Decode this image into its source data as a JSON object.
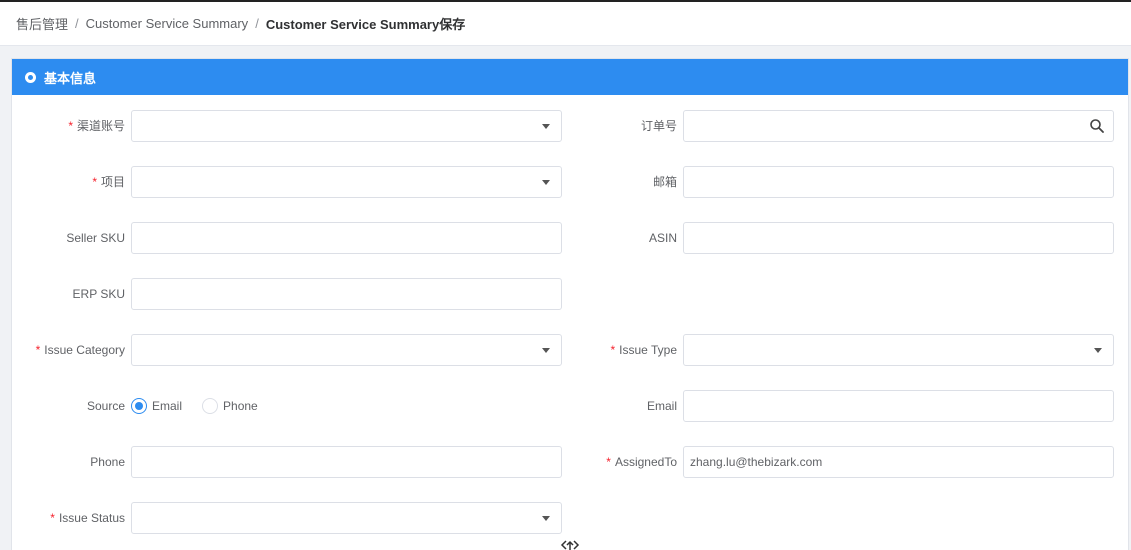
{
  "breadcrumb": {
    "items": [
      "售后管理",
      "Customer Service Summary"
    ],
    "separator": "/",
    "current": "Customer Service Summary保存"
  },
  "panel": {
    "title": "基本信息",
    "icon": "info-circle-icon"
  },
  "form": {
    "channel_account": {
      "label": "渠道账号",
      "required": true,
      "value": ""
    },
    "order_no": {
      "label": "订单号",
      "value": "",
      "icon": "search-icon"
    },
    "project": {
      "label": "项目",
      "required": true,
      "value": ""
    },
    "mailbox": {
      "label": "邮箱",
      "value": ""
    },
    "seller_sku": {
      "label": "Seller SKU",
      "value": ""
    },
    "asin": {
      "label": "ASIN",
      "value": ""
    },
    "erp_sku": {
      "label": "ERP SKU",
      "value": ""
    },
    "issue_category": {
      "label": "Issue Category",
      "required": true,
      "value": ""
    },
    "issue_type": {
      "label": "Issue Type",
      "required": true,
      "value": ""
    },
    "source": {
      "label": "Source",
      "options": [
        "Email",
        "Phone"
      ],
      "selected": "Email"
    },
    "email": {
      "label": "Email",
      "value": ""
    },
    "phone": {
      "label": "Phone",
      "value": ""
    },
    "assigned_to": {
      "label": "AssignedTo",
      "required": true,
      "value": "zhang.lu@thebizark.com"
    },
    "issue_status": {
      "label": "Issue Status",
      "required": true,
      "value": ""
    },
    "required_mark": "*"
  },
  "colors": {
    "primary": "#2d8cf0",
    "required": "#f5222d",
    "border": "#dcdfe6"
  }
}
